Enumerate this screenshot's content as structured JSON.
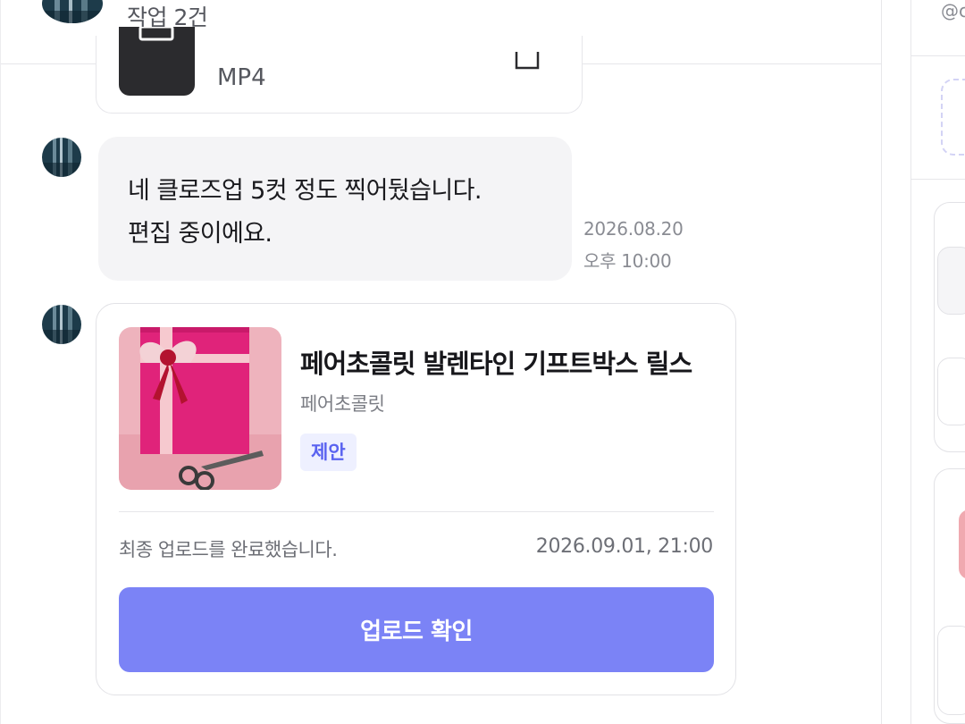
{
  "header": {
    "subtitle": "작업 2건"
  },
  "file_message": {
    "file_type": "MP4",
    "icon": "video-file-icon"
  },
  "text_message": {
    "lines": [
      "네 클로즈업 5컷 정도 찍어뒀습니다.",
      "편집 중이에요."
    ],
    "date": "2026.08.20",
    "time": "오후 10:00"
  },
  "product_message": {
    "title": "페어초콜릿 발렌타인 기프트박스 릴스",
    "brand": "페어초콜릿",
    "tag": "제안",
    "status_text": "최종 업로드를 완료했습니다.",
    "status_date": "2026.09.01, 21:00",
    "button_label": "업로드 확인",
    "image": "pink-gift-box-with-ribbon-and-scissors"
  },
  "side_panel": {
    "handle": "@c"
  },
  "colors": {
    "accent_button": "#7b83f6",
    "tag_background": "#eef0ff",
    "tag_text": "#5a63f0",
    "bubble_background": "#f4f4f6"
  }
}
